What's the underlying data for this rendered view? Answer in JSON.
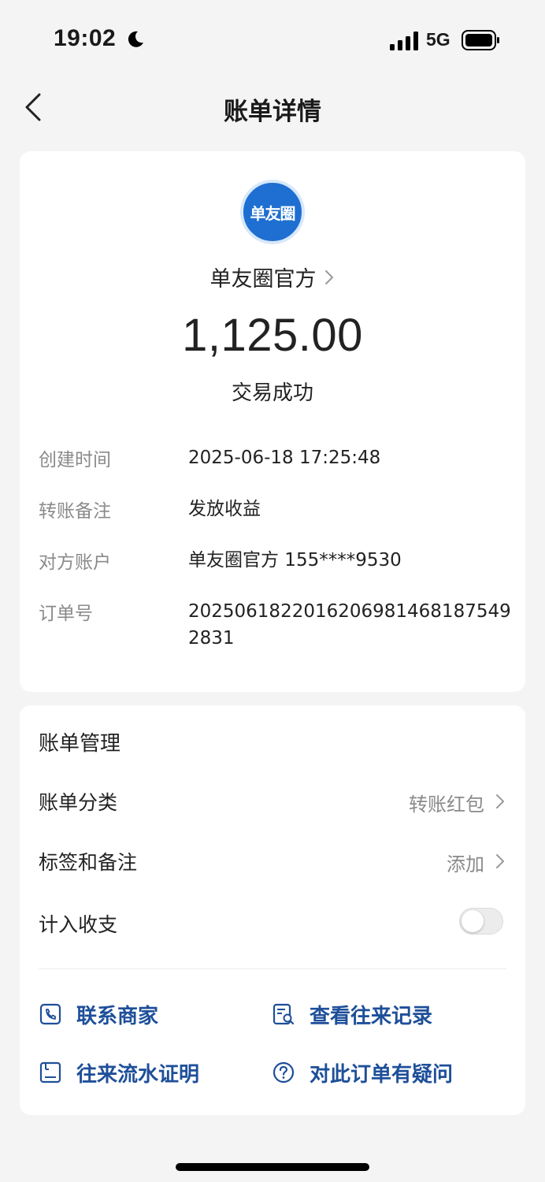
{
  "status_bar": {
    "time": "19:02",
    "network": "5G"
  },
  "nav": {
    "title": "账单详情"
  },
  "merchant": {
    "logo_text": "单友圈",
    "name": "单友圈官方"
  },
  "transaction": {
    "amount": "1,125.00",
    "status": "交易成功"
  },
  "details": [
    {
      "label": "创建时间",
      "value": "2025-06-18 17:25:48"
    },
    {
      "label": "转账备注",
      "value": "发放收益"
    },
    {
      "label": "对方账户",
      "value": "单友圈官方 155****9530"
    },
    {
      "label": "订单号",
      "value": "2025061822016206981468187549 2831"
    }
  ],
  "manage": {
    "title": "账单管理",
    "category_label": "账单分类",
    "category_value": "转账红包",
    "tags_label": "标签和备注",
    "tags_value": "添加",
    "include_label": "计入收支",
    "include_enabled": false
  },
  "actions": {
    "contact": "联系商家",
    "history": "查看往来记录",
    "statement": "往来流水证明",
    "question": "对此订单有疑问"
  },
  "colors": {
    "accent": "#1e4f99",
    "logo_blue": "#1e6fd1",
    "label_gray": "#8a8a8a",
    "background": "#f4f4f4"
  },
  "icons": [
    "moon-icon",
    "signal-icon",
    "battery-icon",
    "back-icon",
    "chevron-right-icon",
    "phone-icon",
    "record-search-icon",
    "statement-icon",
    "question-icon"
  ]
}
